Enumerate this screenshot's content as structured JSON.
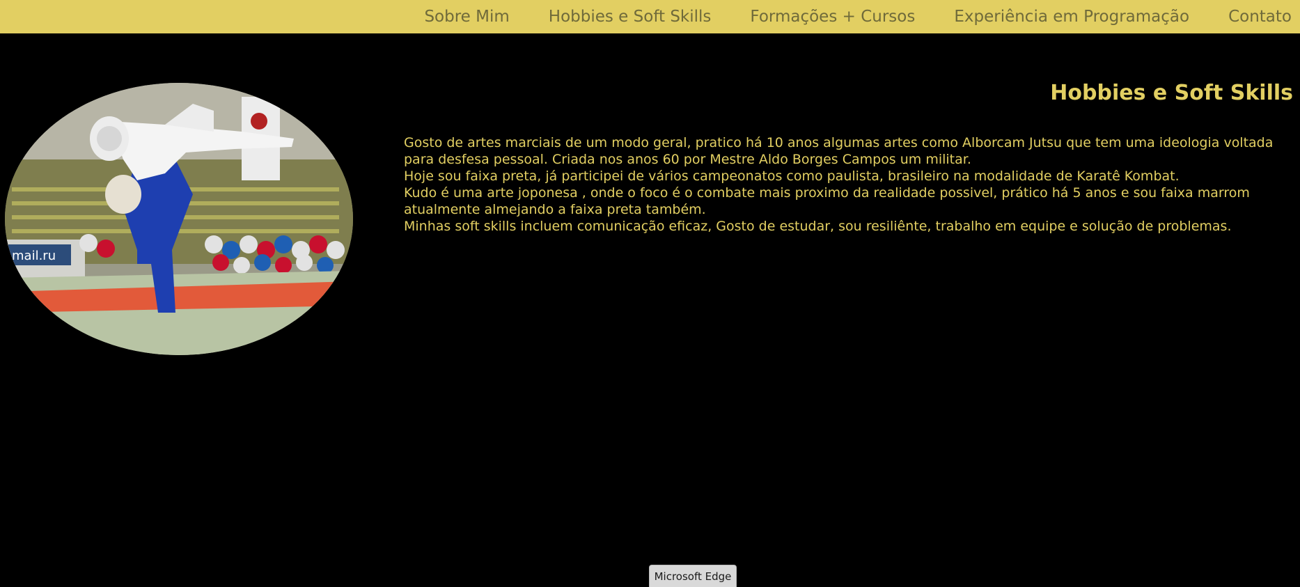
{
  "nav": {
    "items": [
      {
        "label": "Sobre Mim"
      },
      {
        "label": "Hobbies e Soft Skills"
      },
      {
        "label": "Formações + Cursos"
      },
      {
        "label": "Experiência em Programação"
      },
      {
        "label": "Contato"
      }
    ]
  },
  "section": {
    "title": "Hobbies e Soft Skills",
    "image": {
      "banner_text": "mail.ru"
    },
    "paragraphs": [
      "Gosto de artes marciais de um modo geral, pratico há 10 anos algumas artes como Alborcam Jutsu que tem uma ideologia voltada para desfesa pessoal. Criada nos anos 60 por Mestre Aldo Borges Campos um militar.",
      "Hoje sou faixa preta, já participei de vários campeonatos como paulista, brasileiro na modalidade de Karatê Kombat.",
      "Kudo é uma arte joponesa , onde o foco é o combate mais proximo da realidade possivel, prático há 5 anos e sou faixa marrom atualmente almejando a faixa preta também.",
      "Minhas soft skills incluem comunicação eficaz, Gosto de estudar, sou resiliênte, trabalho em equipe e solução de problemas."
    ]
  },
  "tooltip": {
    "label": "Microsoft Edge"
  },
  "colors": {
    "accent": "#e2cf62",
    "nav_text": "#6f6a3a",
    "background": "#000000"
  }
}
